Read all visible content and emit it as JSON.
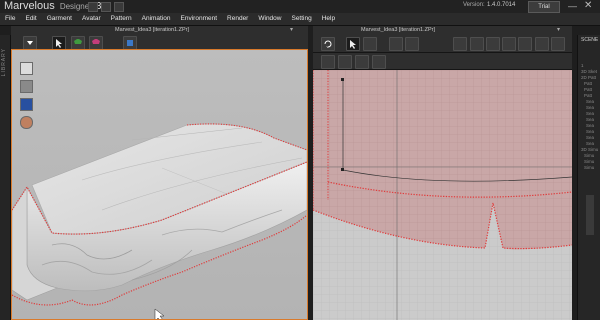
{
  "app": {
    "name": "Marvelous",
    "edition": "Designer",
    "major_version": "3",
    "version_label": "Version:",
    "version_value": "1.4.0.7014",
    "trial": "Trial"
  },
  "menu": [
    "File",
    "Edit",
    "Garment",
    "Avatar",
    "Pattern",
    "Animation",
    "Environment",
    "Render",
    "Window",
    "Setting",
    "Help"
  ],
  "panels": {
    "view3d_tab": "Marvest_Idea3 [iteration1.ZPr]",
    "view2d_tab": "Marvest_Idea3 [iteration1.ZPr]",
    "scene_title": "SCENE",
    "library_label": "LIBRARY"
  },
  "scene_tree": [
    "1",
    "3D Sket",
    "2D Patt",
    "Patt",
    "Patt",
    "Patt",
    "Sea",
    "Sea",
    "Sea",
    "Sea",
    "Sea",
    "Sea",
    "Sea",
    "Sea",
    "3D Simu",
    "Simu",
    "Simu",
    "Simu"
  ],
  "colors": {
    "accent_border": "#d97a2b",
    "pattern_fill": "#c9a7a7",
    "seam_red": "#e03a3a",
    "viewport_bg": "#b8b8b8"
  },
  "icons": [
    "save-icon",
    "undo-icon",
    "redo-icon",
    "arrow-down-icon",
    "select-icon",
    "garment-icon",
    "avatar-icon",
    "fold-icon",
    "rotate-icon",
    "transform-icon",
    "segment-icon",
    "pattern-icon"
  ]
}
